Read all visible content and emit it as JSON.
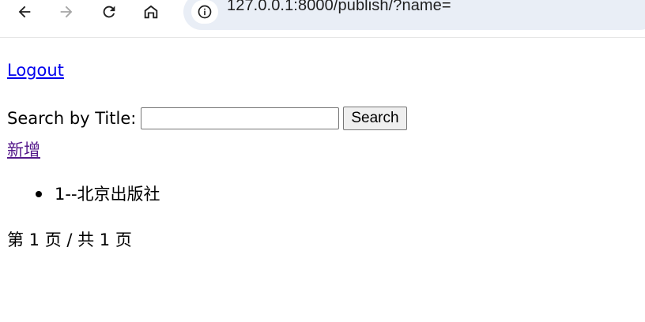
{
  "browser": {
    "url": "127.0.0.1:8000/publish/?name=",
    "icons": [
      "back-arrow-icon",
      "forward-arrow-icon",
      "reload-icon",
      "home-icon",
      "site-info-icon"
    ]
  },
  "page": {
    "logout_label": "Logout",
    "search": {
      "label": "Search by Title:",
      "value": "",
      "button_label": "Search"
    },
    "add_label": "新增",
    "items": [
      {
        "text": "1--北京出版社"
      }
    ],
    "pagination": "第 1 页 / 共 1 页"
  },
  "colors": {
    "link": "#0000ee",
    "visited_link": "#551a8b",
    "omnibox": "#e9eef6"
  }
}
